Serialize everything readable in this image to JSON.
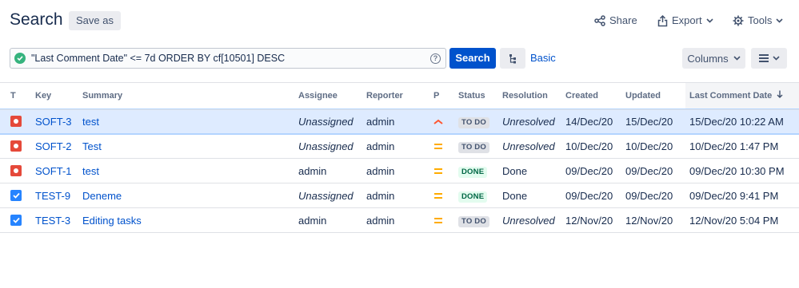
{
  "header": {
    "title": "Search",
    "save_as": "Save as",
    "share": "Share",
    "export": "Export",
    "tools": "Tools"
  },
  "search": {
    "query": "\"Last Comment Date\" <= 7d ORDER BY cf[10501] DESC",
    "search_button": "Search",
    "basic_link": "Basic",
    "columns_button": "Columns"
  },
  "table": {
    "columns": [
      "T",
      "Key",
      "Summary",
      "Assignee",
      "Reporter",
      "P",
      "Status",
      "Resolution",
      "Created",
      "Updated",
      "Last Comment Date"
    ],
    "rows": [
      {
        "type": "bug",
        "key": "SOFT-3",
        "summary": "test",
        "assignee": "Unassigned",
        "reporter": "admin",
        "priority": "high",
        "status": "TO DO",
        "resolution": "Unresolved",
        "created": "14/Dec/20",
        "updated": "15/Dec/20",
        "last_comment": "15/Dec/20 10:22 AM"
      },
      {
        "type": "bug",
        "key": "SOFT-2",
        "summary": "Test",
        "assignee": "Unassigned",
        "reporter": "admin",
        "priority": "medium",
        "status": "TO DO",
        "resolution": "Unresolved",
        "created": "10/Dec/20",
        "updated": "10/Dec/20",
        "last_comment": "10/Dec/20 1:47 PM"
      },
      {
        "type": "bug",
        "key": "SOFT-1",
        "summary": "test",
        "assignee": "admin",
        "reporter": "admin",
        "priority": "medium",
        "status": "DONE",
        "resolution": "Done",
        "created": "09/Dec/20",
        "updated": "09/Dec/20",
        "last_comment": "09/Dec/20 10:30 PM"
      },
      {
        "type": "task",
        "key": "TEST-9",
        "summary": "Deneme",
        "assignee": "Unassigned",
        "reporter": "admin",
        "priority": "medium",
        "status": "DONE",
        "resolution": "Done",
        "created": "09/Dec/20",
        "updated": "09/Dec/20",
        "last_comment": "09/Dec/20 9:41 PM"
      },
      {
        "type": "task",
        "key": "TEST-3",
        "summary": "Editing tasks",
        "assignee": "admin",
        "reporter": "admin",
        "priority": "medium",
        "status": "TO DO",
        "resolution": "Unresolved",
        "created": "12/Nov/20",
        "updated": "12/Nov/20",
        "last_comment": "12/Nov/20 5:04 PM"
      }
    ]
  },
  "icons": {
    "share": "share-icon",
    "export": "export-icon",
    "tools": "gear-icon",
    "valid": "check-circle-icon",
    "help": "help-icon",
    "tree": "hierarchy-icon",
    "menu": "list-icon",
    "sort": "arrow-down-icon",
    "bug": "bug-icon",
    "task": "task-checkbox-icon",
    "priority_high": "priority-high-icon",
    "priority_medium": "priority-medium-icon"
  },
  "colors": {
    "primary": "#0052cc",
    "selected_row": "#deebff",
    "bug": "#e5493a",
    "task": "#2684ff",
    "priority_high": "#ff5630",
    "priority_medium": "#ffab00",
    "done": "#006644",
    "valid": "#36b37e"
  }
}
